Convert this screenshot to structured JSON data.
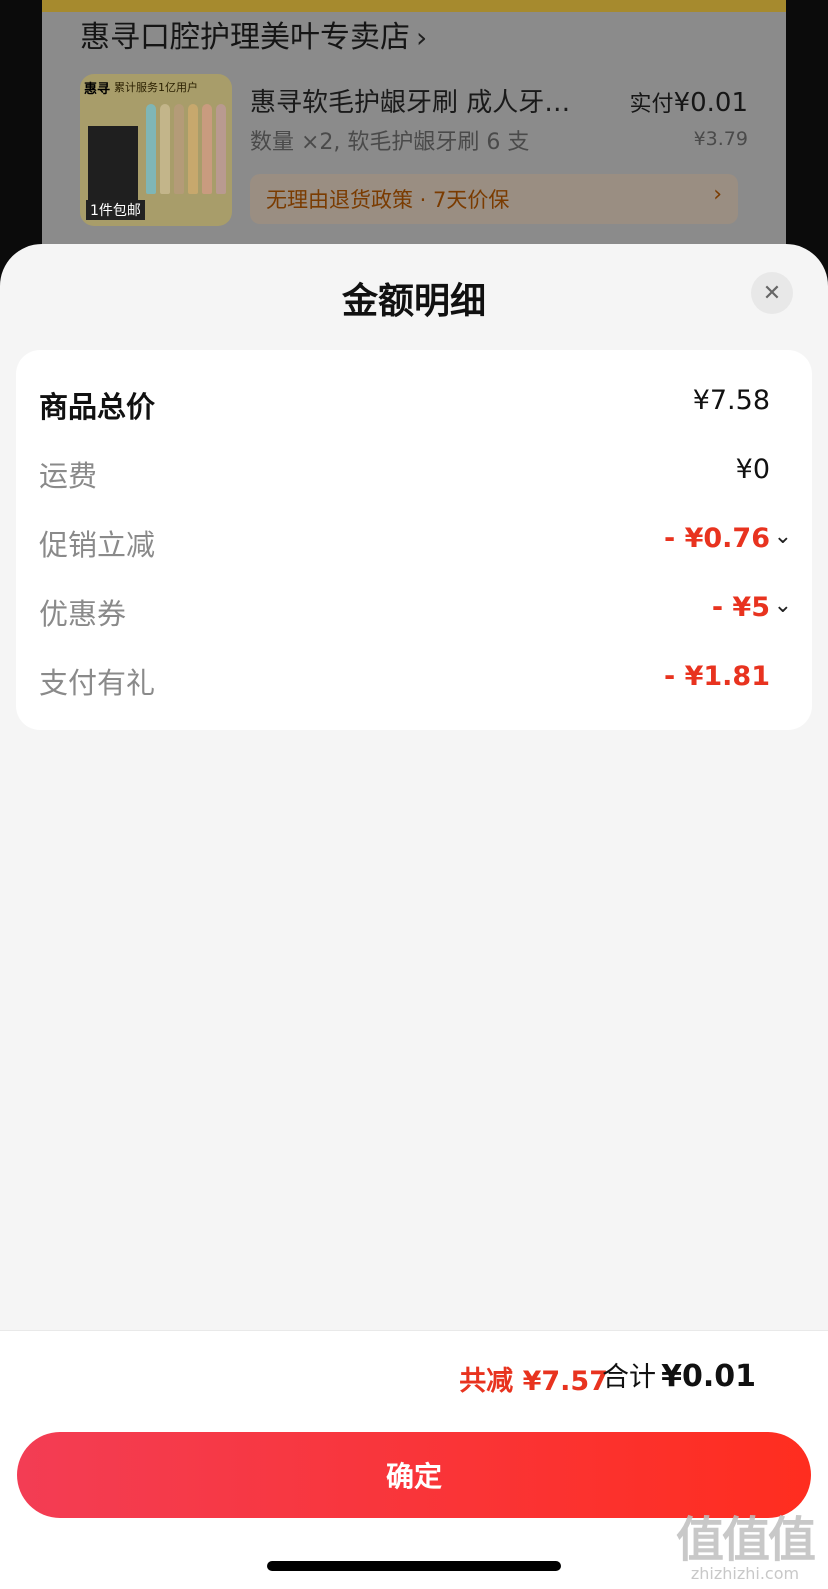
{
  "background_order": {
    "shop_name": "惠寻口腔护理美叶专卖店",
    "product": {
      "thumbnail_brand": "惠寻",
      "thumbnail_tagline": "累计服务1亿用户",
      "thumbnail_shipping": "1件包邮",
      "title": "惠寻软毛护龈牙刷 成人牙…",
      "spec": "数量 ×2, 软毛护龈牙刷 6 支",
      "paid_label": "实付",
      "paid_value": "¥0.01",
      "original_price": "¥3.79",
      "policy_text": "无理由退货政策 · 7天价保"
    }
  },
  "sheet": {
    "title": "金额明细",
    "rows": [
      {
        "label": "商品总价",
        "value": "¥7.58"
      },
      {
        "label": "运费",
        "value": "¥0"
      },
      {
        "label": "促销立减",
        "value": "- ¥0.76"
      },
      {
        "label": "优惠券",
        "value": "- ¥5"
      },
      {
        "label": "支付有礼",
        "value": "- ¥1.81"
      }
    ]
  },
  "footer": {
    "saved_label": "共减",
    "saved_value": "¥7.57",
    "total_label": "合计",
    "total_value": "¥0.01",
    "confirm_label": "确定"
  },
  "watermark": {
    "glyph": "值值值",
    "domain": "zhizhizhi.com"
  },
  "colors": {
    "accent_red": "#e8331f",
    "button_gradient_start": "#f33d54",
    "button_gradient_end": "#ff2d1f",
    "sheet_bg": "#f5f5f5"
  }
}
